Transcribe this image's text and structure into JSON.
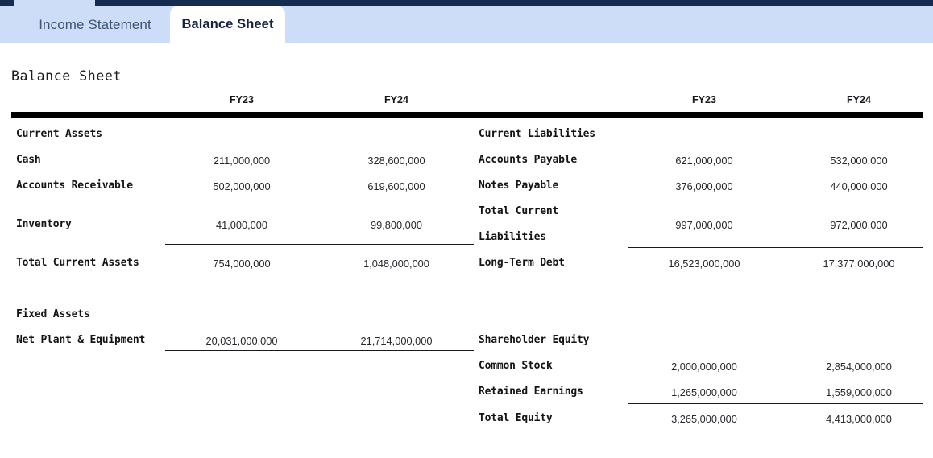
{
  "tabs": [
    {
      "label": "Income Statement",
      "active": false
    },
    {
      "label": "Balance Sheet",
      "active": true
    }
  ],
  "page": {
    "title": "Balance Sheet"
  },
  "colors": {
    "tabbar_background": "#cdddf7",
    "topstrip": "#152c4e",
    "active_tab_background": "#ffffff",
    "active_tab_text": "#16233c",
    "inactive_tab_text": "#3d5573",
    "header_rule": "#000000",
    "label_text": "#141414",
    "number_text": "#25282d"
  },
  "left_table": {
    "columns": [
      "",
      "FY23",
      "FY24"
    ],
    "sections": [
      {
        "heading": "Current Assets",
        "rows": [
          {
            "label": "Cash",
            "fy23": "211,000,000",
            "fy24": "328,600,000"
          },
          {
            "label": "Accounts Receivable",
            "fy23": "502,000,000",
            "fy24": "619,600,000"
          },
          {
            "label": "Inventory",
            "fy23": "41,000,000",
            "fy24": "99,800,000"
          },
          {
            "label": "Total Current Assets",
            "fy23": "754,000,000",
            "fy24": "1,048,000,000",
            "total": true
          }
        ]
      },
      {
        "heading": "Fixed Assets",
        "rows": [
          {
            "label": "Net Plant & Equipment",
            "fy23": "20,031,000,000",
            "fy24": "21,714,000,000"
          }
        ]
      }
    ]
  },
  "right_table": {
    "columns": [
      "",
      "FY23",
      "FY24"
    ],
    "sections": [
      {
        "heading": "Current Liabilities",
        "rows": [
          {
            "label": "Accounts Payable",
            "fy23": "621,000,000",
            "fy24": "532,000,000"
          },
          {
            "label": "Notes Payable",
            "fy23": "376,000,000",
            "fy24": "440,000,000"
          },
          {
            "label_line1": "Total Current",
            "label_line2": "Liabilities",
            "fy23": "997,000,000",
            "fy24": "972,000,000",
            "total": true
          },
          {
            "label": "Long-Term Debt",
            "fy23": "16,523,000,000",
            "fy24": "17,377,000,000"
          }
        ]
      },
      {
        "heading": "Shareholder Equity",
        "rows": [
          {
            "label": "Common Stock",
            "fy23": "2,000,000,000",
            "fy24": "2,854,000,000"
          },
          {
            "label": "Retained Earnings",
            "fy23": "1,265,000,000",
            "fy24": "1,559,000,000"
          },
          {
            "label": "Total Equity",
            "fy23": "3,265,000,000",
            "fy24": "4,413,000,000",
            "total": true
          }
        ]
      }
    ]
  }
}
